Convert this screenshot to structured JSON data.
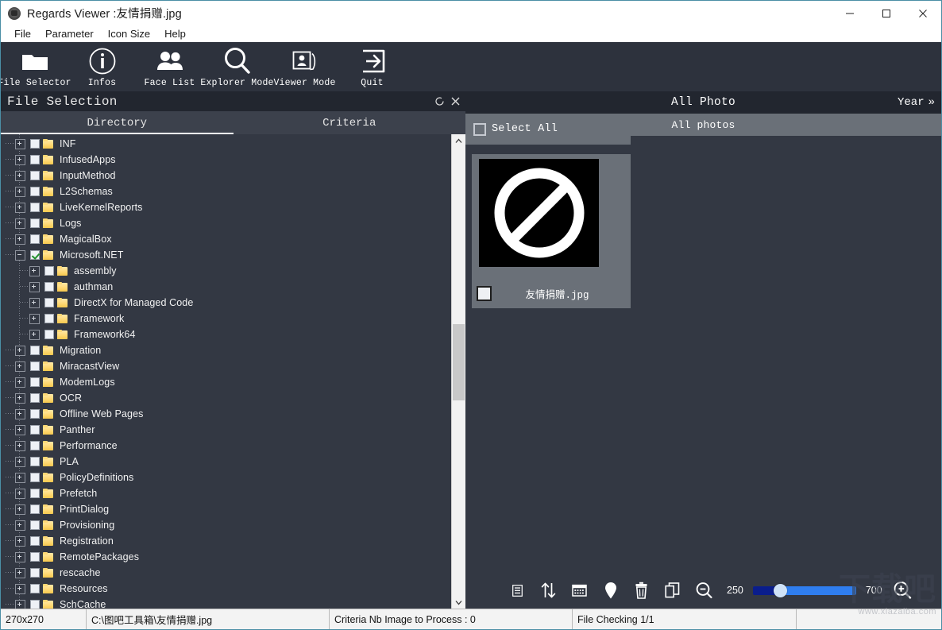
{
  "window": {
    "title": "Regards Viewer :友情捐赠.jpg",
    "app_icon": "camera-icon",
    "minimize": "minimize-icon",
    "maximize": "maximize-icon",
    "close": "close-icon"
  },
  "menubar": {
    "items": [
      {
        "label": "File"
      },
      {
        "label": "Parameter"
      },
      {
        "label": "Icon Size"
      },
      {
        "label": "Help"
      }
    ]
  },
  "toolbar": {
    "buttons": [
      {
        "label": "File Selector",
        "icon": "folder-icon"
      },
      {
        "label": "Infos",
        "icon": "info-circle-icon"
      },
      {
        "label": "Face List",
        "icon": "people-icon"
      },
      {
        "label": "Explorer Mode",
        "icon": "magnifier-icon"
      },
      {
        "label": "Viewer Mode",
        "icon": "photo-stack-icon"
      },
      {
        "label": "Quit",
        "icon": "exit-arrow-icon"
      }
    ]
  },
  "file_selection": {
    "title": "File Selection",
    "refresh_icon": "refresh-icon",
    "close_icon": "close-icon",
    "tabs": [
      {
        "label": "Directory",
        "active": true
      },
      {
        "label": "Criteria",
        "active": false
      }
    ],
    "tree": [
      {
        "label": "INF",
        "level": 0,
        "expander": "plus",
        "checked": false
      },
      {
        "label": "InfusedApps",
        "level": 0,
        "expander": "plus",
        "checked": false
      },
      {
        "label": "InputMethod",
        "level": 0,
        "expander": "plus",
        "checked": false
      },
      {
        "label": "L2Schemas",
        "level": 0,
        "expander": "plus",
        "checked": false
      },
      {
        "label": "LiveKernelReports",
        "level": 0,
        "expander": "plus",
        "checked": false
      },
      {
        "label": "Logs",
        "level": 0,
        "expander": "plus",
        "checked": false
      },
      {
        "label": "MagicalBox",
        "level": 0,
        "expander": "plus",
        "checked": false
      },
      {
        "label": "Microsoft.NET",
        "level": 0,
        "expander": "minus",
        "checked": true
      },
      {
        "label": "assembly",
        "level": 1,
        "expander": "plus",
        "checked": false
      },
      {
        "label": "authman",
        "level": 1,
        "expander": "plus",
        "checked": false
      },
      {
        "label": "DirectX for Managed Code",
        "level": 1,
        "expander": "plus",
        "checked": false
      },
      {
        "label": "Framework",
        "level": 1,
        "expander": "plus",
        "checked": false
      },
      {
        "label": "Framework64",
        "level": 1,
        "expander": "plus",
        "checked": false
      },
      {
        "label": "Migration",
        "level": 0,
        "expander": "plus",
        "checked": false
      },
      {
        "label": "MiracastView",
        "level": 0,
        "expander": "plus",
        "checked": false
      },
      {
        "label": "ModemLogs",
        "level": 0,
        "expander": "plus",
        "checked": false
      },
      {
        "label": "OCR",
        "level": 0,
        "expander": "plus",
        "checked": false
      },
      {
        "label": "Offline Web Pages",
        "level": 0,
        "expander": "plus",
        "checked": false
      },
      {
        "label": "Panther",
        "level": 0,
        "expander": "plus",
        "checked": false
      },
      {
        "label": "Performance",
        "level": 0,
        "expander": "plus",
        "checked": false
      },
      {
        "label": "PLA",
        "level": 0,
        "expander": "plus",
        "checked": false
      },
      {
        "label": "PolicyDefinitions",
        "level": 0,
        "expander": "plus",
        "checked": false
      },
      {
        "label": "Prefetch",
        "level": 0,
        "expander": "plus",
        "checked": false
      },
      {
        "label": "PrintDialog",
        "level": 0,
        "expander": "plus",
        "checked": false
      },
      {
        "label": "Provisioning",
        "level": 0,
        "expander": "plus",
        "checked": false
      },
      {
        "label": "Registration",
        "level": 0,
        "expander": "plus",
        "checked": false
      },
      {
        "label": "RemotePackages",
        "level": 0,
        "expander": "plus",
        "checked": false
      },
      {
        "label": "rescache",
        "level": 0,
        "expander": "plus",
        "checked": false
      },
      {
        "label": "Resources",
        "level": 0,
        "expander": "plus",
        "checked": false
      },
      {
        "label": "SchCache",
        "level": 0,
        "expander": "plus",
        "checked": false
      }
    ]
  },
  "photo_panel": {
    "header_title": "All Photo",
    "year_label": "Year",
    "year_chevron": "»",
    "band_label": "All photos",
    "select_all_label": "Select All",
    "select_all_checked": false,
    "thumbnails": [
      {
        "filename": "友情捐赠.jpg",
        "checked": false,
        "preview": "no-entry-icon"
      }
    ]
  },
  "bottom_toolbar": {
    "icons": [
      "list-view-icon",
      "sort-icon",
      "calendar-icon",
      "location-pin-icon",
      "trash-icon",
      "copy-icon",
      "zoom-out-icon"
    ],
    "zoom_min": "250",
    "zoom_max": "700",
    "slider_value_pct": 22
  },
  "statusbar": {
    "cells": [
      "270x270",
      "C:\\图吧工具箱\\友情捐赠.jpg",
      "Criteria Nb Image to Process :  0",
      "File Checking 1/1",
      ""
    ]
  },
  "watermark": {
    "main": "下载吧",
    "sub": "www.xiazaiba.com"
  },
  "colors": {
    "app_bg": "#333843",
    "toolbar_bg": "#2d323d",
    "header_bg": "#22262f",
    "panel_gray": "#6a7078",
    "accent_blue": "#2f7ef0",
    "folder_yellow": "#ffd976",
    "check_green": "#1f8f2a"
  }
}
